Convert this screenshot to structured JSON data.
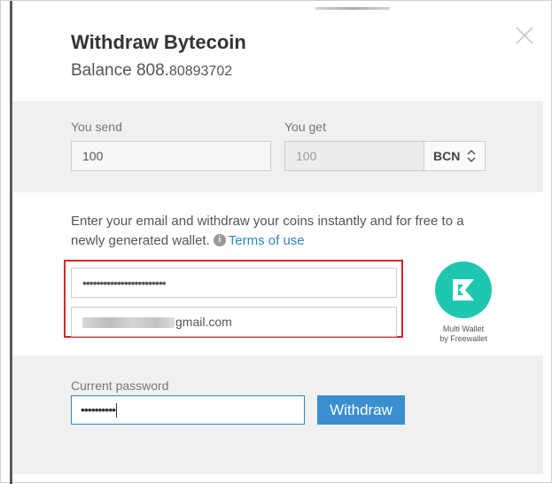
{
  "dialog": {
    "title": "Withdraw Bytecoin",
    "balance_prefix": "Balance 808.",
    "balance_decimals": "80893702"
  },
  "send": {
    "you_send_label": "You send",
    "you_send_value": "100",
    "you_get_label": "You get",
    "you_get_value": "100",
    "currency": "BCN"
  },
  "email_section": {
    "description": "Enter your email and withdraw your coins instantly and for free to a newly generated wallet.",
    "info_icon": "i",
    "terms_link": "Terms of use",
    "masked_field": "••••••••••••••••••••••••",
    "email_visible_suffix": "gmail.com",
    "logo_icon": "multi-wallet-logo",
    "logo_caption_line1": "Multi Wallet",
    "logo_caption_line2": "by Freewallet"
  },
  "password_section": {
    "label": "Current password",
    "value": "••••••••••",
    "withdraw_button": "Withdraw"
  },
  "colors": {
    "accent": "#3a8fd0",
    "link": "#2e86c1",
    "highlight": "#d9242a",
    "logo": "#1fc7b0"
  }
}
